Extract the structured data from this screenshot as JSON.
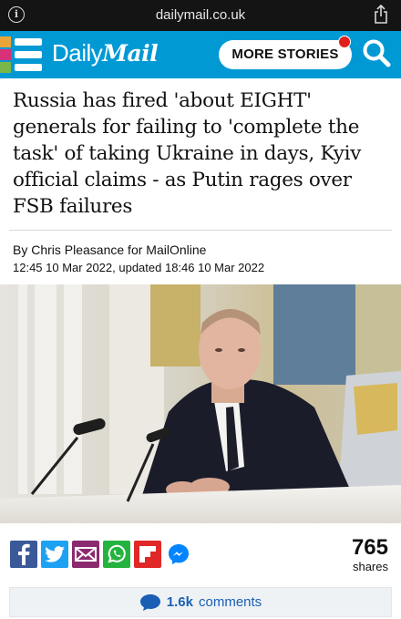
{
  "browser": {
    "url": "dailymail.co.uk",
    "info_icon": "info-icon",
    "share_icon": "share-icon"
  },
  "header": {
    "logo_daily": "Daily",
    "logo_mail": "Mail",
    "more_stories_label": "MORE STORIES",
    "menu_icon": "hamburger-menu-icon",
    "search_icon": "search-icon",
    "brand_color": "#0099d4",
    "notification_color": "#e0201a"
  },
  "article": {
    "headline": "Russia has fired 'about EIGHT' generals for failing to 'complete the task' of taking Ukraine in days, Kyiv official claims - as Putin rages over FSB failures",
    "byline": "By Chris Pleasance for MailOnline",
    "dateline": "12:45 10 Mar 2022, updated 18:46 10 Mar 2022"
  },
  "share": {
    "buttons": [
      {
        "name": "facebook",
        "icon": "facebook-icon",
        "color": "#3b5998"
      },
      {
        "name": "twitter",
        "icon": "twitter-icon",
        "color": "#1da1f2"
      },
      {
        "name": "email",
        "icon": "email-icon",
        "color": "#8b2a6e"
      },
      {
        "name": "whatsapp",
        "icon": "whatsapp-icon",
        "color": "#25b33f"
      },
      {
        "name": "flipboard",
        "icon": "flipboard-icon",
        "color": "#e12828"
      },
      {
        "name": "messenger",
        "icon": "messenger-icon",
        "color": "#0084ff"
      }
    ],
    "count": "765",
    "count_label": "shares"
  },
  "comments": {
    "count": "1.6k",
    "label": "comments",
    "icon": "comment-bubble-icon"
  }
}
